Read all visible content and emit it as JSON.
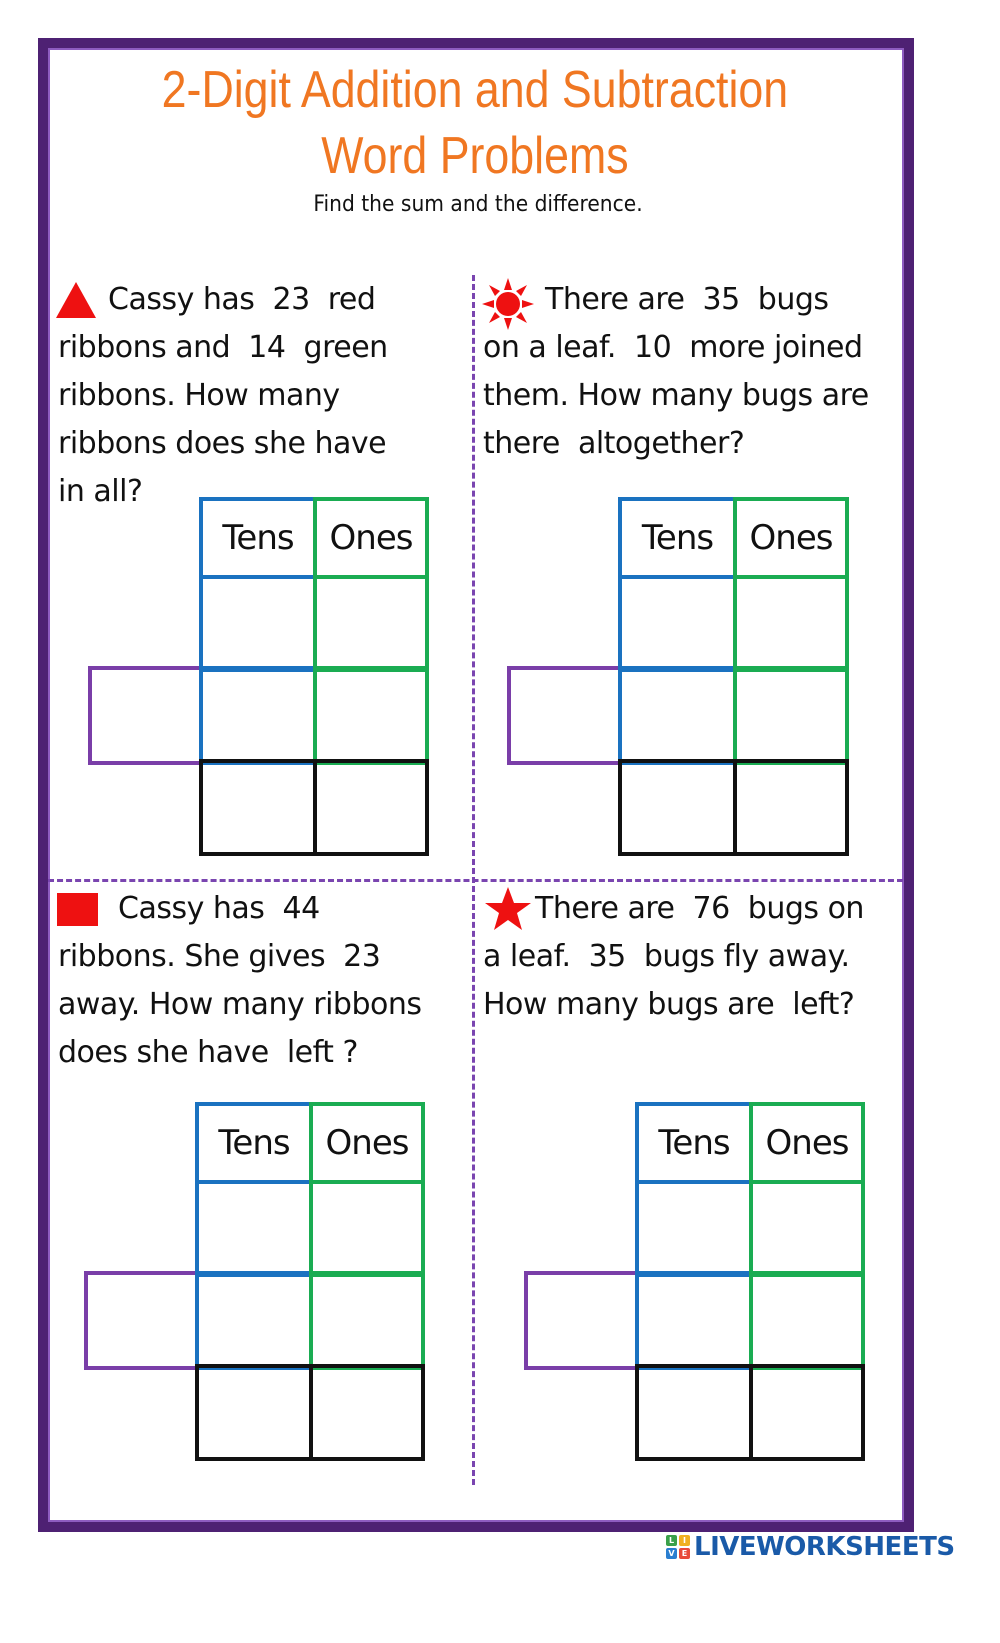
{
  "worksheet": {
    "title_line1": "2-Digit Addition and Subtraction",
    "title_line2": "Word Problems",
    "instructions": "Find the sum and the difference.",
    "colors": {
      "frame": "#4e2173",
      "title": "#f07722",
      "divider": "#7a45b0",
      "tens_column": "#1a72c0",
      "ones_column": "#1aac52",
      "sign_box": "#7a3ea8",
      "answer_row": "#111111",
      "marker": "#ee1111"
    }
  },
  "problems": [
    {
      "marker_icon": "triangle-icon",
      "lines": [
        "Cassy has  23  red",
        "ribbons and  14  green",
        "ribbons. How many",
        "ribbons does she have",
        "in all?"
      ],
      "table": {
        "tens_label": "Tens",
        "ones_label": "Ones"
      }
    },
    {
      "marker_icon": "sun-icon",
      "lines": [
        "There are  35  bugs",
        "on a leaf.  10  more joined",
        "them. How many bugs are",
        "there  altogether?"
      ],
      "table": {
        "tens_label": "Tens",
        "ones_label": "Ones"
      }
    },
    {
      "marker_icon": "square-icon",
      "lines": [
        "Cassy has  44",
        "ribbons. She gives  23",
        "away. How many ribbons",
        "does she have  left ?"
      ],
      "table": {
        "tens_label": "Tens",
        "ones_label": "Ones"
      }
    },
    {
      "marker_icon": "star-icon",
      "lines": [
        "There are  76  bugs on",
        "a leaf.  35  bugs fly away.",
        "How many bugs are  left?"
      ],
      "table": {
        "tens_label": "Tens",
        "ones_label": "Ones"
      }
    }
  ],
  "footer": {
    "brand": "LIVEWORKSHEETS",
    "logo_letters": [
      "L",
      "I",
      "V",
      "E"
    ]
  }
}
